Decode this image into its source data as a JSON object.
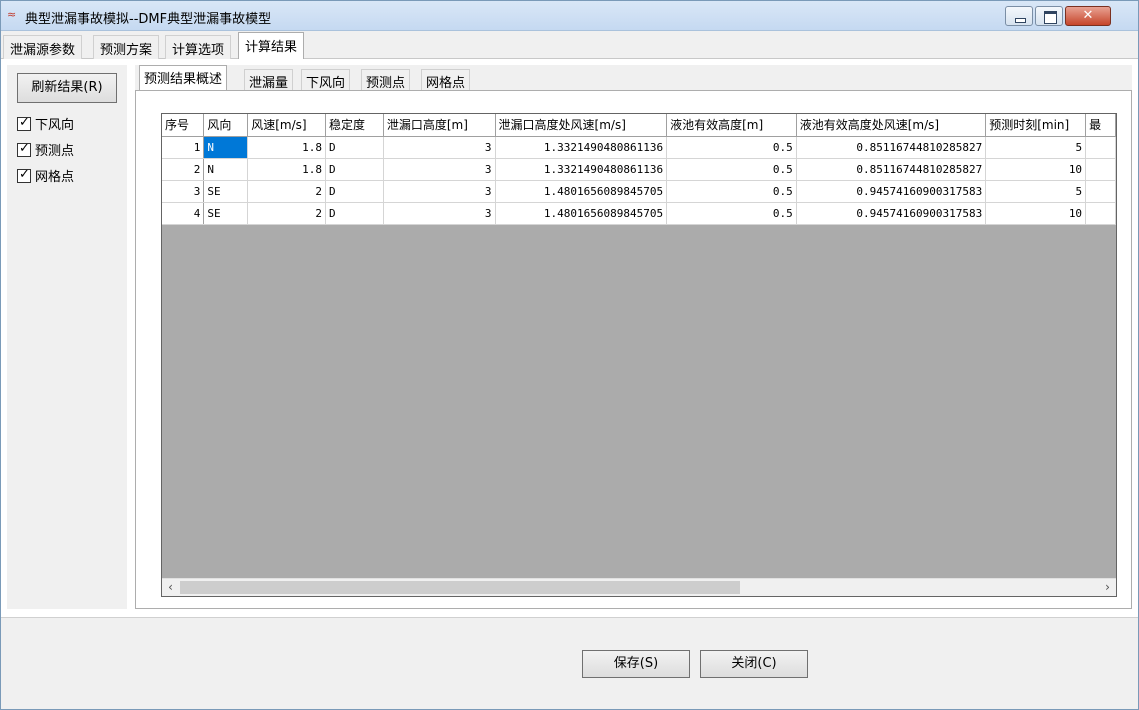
{
  "window": {
    "title": "典型泄漏事故模拟--DMF典型泄漏事故模型"
  },
  "main_tabs": [
    {
      "label": "泄漏源参数"
    },
    {
      "label": "预测方案"
    },
    {
      "label": "计算选项"
    },
    {
      "label": "计算结果"
    }
  ],
  "left_pane": {
    "refresh_label": "刷新结果(R)",
    "checkboxes": [
      {
        "label": "下风向",
        "checked": true
      },
      {
        "label": "预测点",
        "checked": true
      },
      {
        "label": "网格点",
        "checked": true
      }
    ]
  },
  "sub_tabs": [
    {
      "label": "预测结果概述"
    },
    {
      "label": "泄漏量"
    },
    {
      "label": "下风向"
    },
    {
      "label": "预测点"
    },
    {
      "label": "网格点"
    }
  ],
  "table": {
    "headers": [
      "序号",
      "风向",
      "风速[m/s]",
      "稳定度",
      "泄漏口高度[m]",
      "泄漏口高度处风速[m/s]",
      "液池有效高度[m]",
      "液池有效高度处风速[m/s]",
      "预测时刻[min]",
      "最"
    ],
    "rows": [
      [
        "1",
        "N",
        "1.8",
        "D",
        "3",
        "1.3321490480861136",
        "0.5",
        "0.85116744810285827",
        "5"
      ],
      [
        "2",
        "N",
        "1.8",
        "D",
        "3",
        "1.3321490480861136",
        "0.5",
        "0.85116744810285827",
        "10"
      ],
      [
        "3",
        "SE",
        "2",
        "D",
        "3",
        "1.4801656089845705",
        "0.5",
        "0.94574160900317583",
        "5"
      ],
      [
        "4",
        "SE",
        "2",
        "D",
        "3",
        "1.4801656089845705",
        "0.5",
        "0.94574160900317583",
        "10"
      ]
    ]
  },
  "buttons": {
    "save": "保存(S)",
    "close": "关闭(C)"
  }
}
